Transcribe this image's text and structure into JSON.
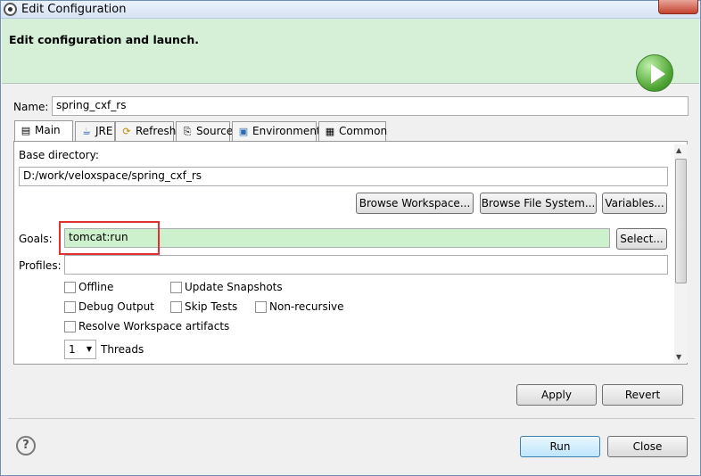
{
  "window": {
    "title": "Edit Configuration"
  },
  "banner": {
    "title": "Edit configuration and launch."
  },
  "name_field": {
    "label": "Name:",
    "value": "spring_cxf_rs"
  },
  "tabs": [
    {
      "label": "Main",
      "icon": "main-tab-icon"
    },
    {
      "label": "JRE",
      "icon": "jre-icon"
    },
    {
      "label": "Refresh",
      "icon": "refresh-icon"
    },
    {
      "label": "Source",
      "icon": "source-icon"
    },
    {
      "label": "Environment",
      "icon": "environment-icon"
    },
    {
      "label": "Common",
      "icon": "common-icon"
    }
  ],
  "main_tab": {
    "base_dir_label": "Base directory:",
    "base_dir_value": "D:/work/veloxspace/spring_cxf_rs",
    "browse_workspace": "Browse Workspace...",
    "browse_fs": "Browse File System...",
    "variables": "Variables...",
    "goals_label": "Goals:",
    "goals_value": "tomcat:run",
    "select": "Select...",
    "profiles_label": "Profiles:",
    "profiles_value": "",
    "offline": "Offline",
    "update_snapshots": "Update Snapshots",
    "debug_output": "Debug Output",
    "skip_tests": "Skip Tests",
    "non_recursive": "Non-recursive",
    "resolve_workspace": "Resolve Workspace artifacts",
    "threads_value": "1",
    "threads_label": "Threads"
  },
  "footer": {
    "apply": "Apply",
    "revert": "Revert",
    "run": "Run",
    "close": "Close",
    "help": "?"
  },
  "colors": {
    "banner_bg": "#d6f0d8",
    "goals_bg": "#cdf0cd",
    "highlight": "#e03030"
  }
}
